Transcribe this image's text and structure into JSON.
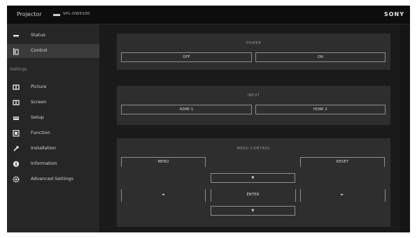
{
  "header": {
    "title": "Projector",
    "model": "VPL-DW5100",
    "brand": "SONY"
  },
  "sidebar": {
    "items": [
      {
        "label": "Status",
        "icon": "status-icon"
      },
      {
        "label": "Control",
        "icon": "control-icon"
      }
    ],
    "settings_heading": "Settings",
    "settings_items": [
      {
        "label": "Picture",
        "icon": "picture-icon"
      },
      {
        "label": "Screen",
        "icon": "screen-icon"
      },
      {
        "label": "Setup",
        "icon": "setup-icon"
      },
      {
        "label": "Function",
        "icon": "function-icon"
      },
      {
        "label": "Installation",
        "icon": "installation-icon"
      },
      {
        "label": "Information",
        "icon": "information-icon"
      },
      {
        "label": "Advanced Settings",
        "icon": "advanced-settings-icon"
      }
    ]
  },
  "power": {
    "title": "POWER",
    "off_label": "OFF",
    "on_label": "ON"
  },
  "input": {
    "title": "INPUT",
    "hdmi1_label": "HDMI 1",
    "hdmi2_label": "HDMI 2"
  },
  "menu_control": {
    "title": "MENU CONTROL",
    "menu_label": "MENU",
    "reset_label": "RESET",
    "up_label": "▼",
    "down_label": "▼",
    "left_label": "◄",
    "right_label": "►",
    "enter_label": "ENTER"
  },
  "colors": {
    "background": "#1c1c1c",
    "sidebar": "#262626",
    "panel": "#2e2e2e",
    "active_item": "#3b3b3b",
    "button_border": "#8e8e8e"
  }
}
